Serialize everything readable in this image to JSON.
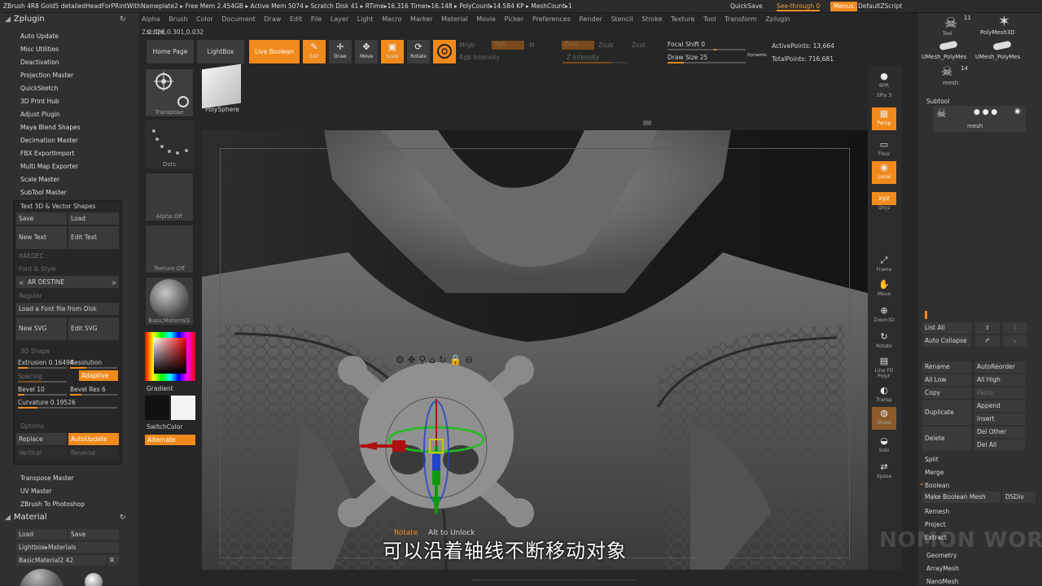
{
  "window": {
    "title": "ZBrush 4R8 Gold5  detailedHeadForPRintWithNameplate2  ▸ Free Mem 2.454GB ▸ Active Mem 5074 ▸ Scratch Disk 41 ▸ RTime▸16.316 Timer▸16.148 ▸ PolyCount▸14.584 KP ▸ MeshCount▸1",
    "quicksave": "QuickSave",
    "see_through": "See-through  0",
    "menus": "Menus",
    "default_zscript": "DefaultZScript"
  },
  "menubar": [
    "Alpha",
    "Brush",
    "Color",
    "Document",
    "Draw",
    "Edit",
    "File",
    "Layer",
    "Light",
    "Macro",
    "Marker",
    "Material",
    "Movie",
    "Picker",
    "Preferences",
    "Render",
    "Stencil",
    "Stroke",
    "Texture",
    "Tool",
    "Transform",
    "Zplugin",
    "Zscript"
  ],
  "coords": "0.026,0.301,0.032",
  "shelf": {
    "home_page": "Home Page",
    "lightbox": "LightBox",
    "live_boolean": "Live Boolean",
    "tools": [
      {
        "icon": "✎",
        "label": "Edit"
      },
      {
        "icon": "✛",
        "label": "Draw"
      },
      {
        "icon": "✥",
        "label": "Move"
      },
      {
        "icon": "▣",
        "label": "Scale"
      },
      {
        "icon": "⟳",
        "label": "Rotate"
      }
    ],
    "mrgb": "Mrgb",
    "rgb": "Rgb",
    "m": "M",
    "rgb_intensity": "Rgb Intensity",
    "zadd": "Zadd",
    "zsub": "Zsub",
    "zcut": "Zcut",
    "z_intensity": "Z Intensity",
    "focal_shift": "Focal Shift 0",
    "draw_size": "Draw Size 25",
    "dynamic": "Dynamic",
    "active_points": "ActivePoints: 13,664",
    "total_points": "TotalPoints: 716,681"
  },
  "zplugin": {
    "title": "Zplugin",
    "items": [
      "Auto Update",
      "Misc Utilities",
      "Deactivation",
      "Projection Master",
      "QuickSketch",
      "3D Print Hub",
      "Adjust Plugin",
      "Maya Blend Shapes",
      "Decimation Master",
      "FBX ExportImport",
      "Multi Map Exporter",
      "Scale Master",
      "SubTool Master",
      "Text 3D & Vector Shapes"
    ],
    "text3d": {
      "save": "Save",
      "load": "Load",
      "new_text": "New Text",
      "edit_text": "Edit Text",
      "sample": "XAEDEC",
      "font_style": "Font & Style",
      "font_name": "AR DESTINE",
      "font_weight": "Regular",
      "load_font": "Load a Font file from Disk",
      "new_svg": "New SVG",
      "edit_svg": "Edit SVG",
      "shape_header": "3D Shape",
      "extrusion": "Extrusion 0.16494",
      "resolution": "Resolution",
      "spacing": "Spacing",
      "adaptive": "Adaptive",
      "bevel": "Bevel 10",
      "bevel_res": "Bevel Res 6",
      "curvature": "Curvature 0.19526",
      "options": "Options",
      "replace": "Replace",
      "autoupdate": "AutoUpdate",
      "vertical": "Vertical",
      "reverse": "Reverse"
    },
    "items_after": [
      "Transpose Master",
      "UV Master",
      "ZBrush To Photoshop"
    ]
  },
  "material": {
    "title": "Material",
    "load": "Load",
    "save": "Save",
    "lightbox": "Lightbox▸Materials",
    "current": "BasicMaterial2  42",
    "r": "R"
  },
  "toolcol": {
    "transpose": "Transpose",
    "polysphere": "PolySphere",
    "dots": "Dots",
    "alpha_off": "Alpha Off",
    "texture_off": "Texture Off",
    "basic_material": "BasicMaterial2",
    "gradient": "Gradient",
    "switch_color": "SwitchColor",
    "alternate": "Alternate"
  },
  "gizmo": {
    "unlock_hint": "Alt to Unlock",
    "unlock_prefix": "Rotate"
  },
  "rightstrip": [
    {
      "icon": "●",
      "label": "BPR"
    },
    {
      "icon": "SPix 3",
      "label": ""
    },
    {
      "icon": "▦",
      "label": "Persp"
    },
    {
      "icon": "▭",
      "label": "Floor"
    },
    {
      "icon": "◉",
      "label": "Local"
    },
    {
      "icon": "xyz",
      "label": "Qxyz"
    },
    {
      "icon": "⤢",
      "label": "Frame"
    },
    {
      "icon": "✋",
      "label": "Move"
    },
    {
      "icon": "⊕",
      "label": "Zoom3D"
    },
    {
      "icon": "↻",
      "label": "Rotate"
    },
    {
      "icon": "▤",
      "label": "Line Fill PolyF"
    },
    {
      "icon": "◐",
      "label": "Transp"
    },
    {
      "icon": "◍",
      "label": "Ghost"
    },
    {
      "icon": "◒",
      "label": "Solo"
    },
    {
      "icon": "⇄",
      "label": "Xpose"
    }
  ],
  "rightpanel": {
    "tools": [
      {
        "name": "Tool",
        "count": "11"
      },
      {
        "name": "PolyMesh3D",
        "count": ""
      },
      {
        "name": "UMesh_PolyMes",
        "count": ""
      },
      {
        "name": "UMesh_PolyMes",
        "count": ""
      },
      {
        "name": "mesh",
        "count": "14"
      }
    ],
    "subtool": "Subtool",
    "subtool_mesh": "mesh",
    "list_all": "List All",
    "auto_collapse": "Auto Collapse",
    "rename": "Rename",
    "auto_reorder": "AutoReorder",
    "all_low": "All Low",
    "all_high": "All High",
    "copy": "Copy",
    "paste": "Paste",
    "duplicate": "Duplicate",
    "append": "Append",
    "insert": "Insert",
    "delete": "Delete",
    "del_other": "Del Other",
    "del_all": "Del All",
    "split": "Split",
    "merge": "Merge",
    "boolean": "Boolean",
    "make_boolean_mesh": "Make Boolean Mesh",
    "dsdiv": "DSDiv",
    "remesh": "Remesh",
    "project": "Project",
    "extract": "Extract",
    "geometry": "Geometry",
    "arraymesh": "ArrayMesh",
    "nanomesh": "NanoMesh"
  },
  "subtitle": "可以沿着轴线不断移动对象",
  "watermark": "NOMON WORKSHOP",
  "colors": {
    "accent": "#f08a1c",
    "panel": "#303030",
    "viewport": "#1e1e1e"
  }
}
